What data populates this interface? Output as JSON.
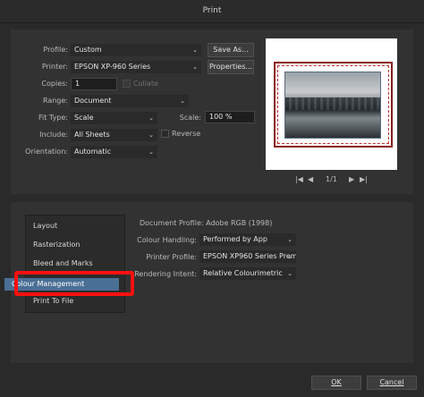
{
  "window": {
    "title": "Print"
  },
  "print_settings": {
    "profile": {
      "label": "Profile:",
      "value": "Custom"
    },
    "printer": {
      "label": "Printer:",
      "value": "EPSON XP-960 Series"
    },
    "copies": {
      "label": "Copies:",
      "value": "1",
      "collate_label": "Collate"
    },
    "range": {
      "label": "Range:",
      "value": "Document"
    },
    "fit_type": {
      "label": "Fit Type:",
      "value": "Scale"
    },
    "scale": {
      "label": "Scale:",
      "value": "100 %"
    },
    "include": {
      "label": "Include:",
      "value": "All Sheets",
      "reverse_label": "Reverse"
    },
    "orientation": {
      "label": "Orientation:",
      "value": "Automatic"
    }
  },
  "buttons": {
    "save_as": "Save As...",
    "properties": "Properties...",
    "ok": "OK",
    "cancel": "Cancel"
  },
  "preview": {
    "page_indicator": "1/1",
    "nav": {
      "first": "|◀",
      "prev": "◀",
      "next": "▶",
      "last": "▶|"
    }
  },
  "sidebar": {
    "items": [
      {
        "label": "Layout"
      },
      {
        "label": "Rasterization"
      },
      {
        "label": "Bleed and Marks"
      },
      {
        "label": "Colour Management"
      },
      {
        "label": "Print To File"
      }
    ]
  },
  "colour_management": {
    "document_profile": {
      "label": "Document Profile:",
      "value": "Adobe RGB (1998)"
    },
    "colour_handling": {
      "label": "Colour Handling:",
      "value": "Performed by App"
    },
    "printer_profile": {
      "label": "Printer Profile:",
      "value": "EPSON XP960 Series Prem"
    },
    "rendering_intent": {
      "label": "Rendering Intent:",
      "value": "Relative Colourimetric"
    }
  },
  "highlight_color": "#ff1010"
}
